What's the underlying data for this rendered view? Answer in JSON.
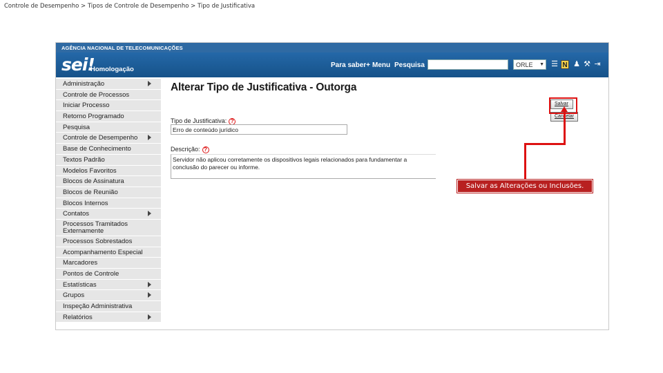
{
  "breadcrumb": "Controle de Desempenho > Tipos de Controle de Desempenho > Tipo de Justificativa",
  "header": {
    "agency": "AGÊNCIA NACIONAL DE TELECOMUNICAÇÕES",
    "logo": "sei!",
    "environment": "Homologação",
    "nav_para_saber": "Para saber+",
    "nav_menu": "Menu",
    "nav_pesquisa": "Pesquisa",
    "search_value": "",
    "unit_selected": "ORLE",
    "icons": [
      "list-icon",
      "n-icon",
      "user-icon",
      "wrench-icon",
      "exit-icon"
    ]
  },
  "sidebar": {
    "items": [
      {
        "label": "Administração",
        "submenu": true
      },
      {
        "label": "Controle de Processos",
        "submenu": false
      },
      {
        "label": "Iniciar Processo",
        "submenu": false
      },
      {
        "label": "Retorno Programado",
        "submenu": false
      },
      {
        "label": "Pesquisa",
        "submenu": false
      },
      {
        "label": "Controle de Desempenho",
        "submenu": true
      },
      {
        "label": "Base de Conhecimento",
        "submenu": false
      },
      {
        "label": "Textos Padrão",
        "submenu": false
      },
      {
        "label": "Modelos Favoritos",
        "submenu": false
      },
      {
        "label": "Blocos de Assinatura",
        "submenu": false
      },
      {
        "label": "Blocos de Reunião",
        "submenu": false
      },
      {
        "label": "Blocos Internos",
        "submenu": false
      },
      {
        "label": "Contatos",
        "submenu": true
      },
      {
        "label": "Processos Tramitados Externamente",
        "submenu": false
      },
      {
        "label": "Processos Sobrestados",
        "submenu": false
      },
      {
        "label": "Acompanhamento Especial",
        "submenu": false
      },
      {
        "label": "Marcadores",
        "submenu": false
      },
      {
        "label": "Pontos de Controle",
        "submenu": false
      },
      {
        "label": "Estatísticas",
        "submenu": true
      },
      {
        "label": "Grupos",
        "submenu": true
      },
      {
        "label": "Inspeção Administrativa",
        "submenu": false
      },
      {
        "label": "Relatórios",
        "submenu": true
      }
    ]
  },
  "main": {
    "title": "Alterar Tipo de Justificativa - Outorga",
    "save_label": "Salvar",
    "cancel_label": "Cancelar",
    "tipo_label": "Tipo de Justificativa:",
    "tipo_value": "Erro de conteúdo jurídico",
    "descricao_label": "Descrição:",
    "descricao_value": "Servidor não aplicou corretamente os dispositivos legais relacionados para fundamentar a conclusão do parecer ou informe.",
    "help_glyph": "?"
  },
  "callout": {
    "text": "Salvar as Alterações ou Inclusões.",
    "color": "#b82020"
  }
}
